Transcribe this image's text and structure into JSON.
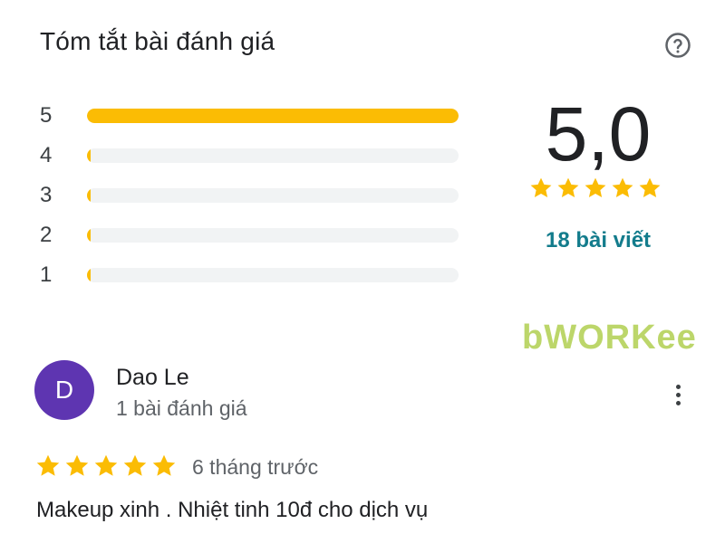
{
  "summary": {
    "title": "Tóm tắt bài đánh giá",
    "help_icon": "question-circle-icon",
    "distribution": [
      {
        "label": "5",
        "fraction": 1.0
      },
      {
        "label": "4",
        "fraction": 0.0
      },
      {
        "label": "3",
        "fraction": 0.0
      },
      {
        "label": "2",
        "fraction": 0.0
      },
      {
        "label": "1",
        "fraction": 0.0
      }
    ],
    "score": "5,0",
    "score_stars": 5,
    "review_count": "18 bài viết"
  },
  "watermark": {
    "text": "bWORKee"
  },
  "review": {
    "avatar_letter": "D",
    "reviewer_name": "Dao Le",
    "reviewer_meta": "1 bài đánh giá",
    "stars": 5,
    "time": "6 tháng trước",
    "text": "Makeup xinh . Nhiệt tinh 10đ cho dịch vụ",
    "more_icon": "more-vertical-icon"
  },
  "colors": {
    "star": "#fbbc04",
    "bar_track": "#f1f3f4",
    "avatar_bg": "#5e35b1",
    "review_count": "#137c8c"
  }
}
